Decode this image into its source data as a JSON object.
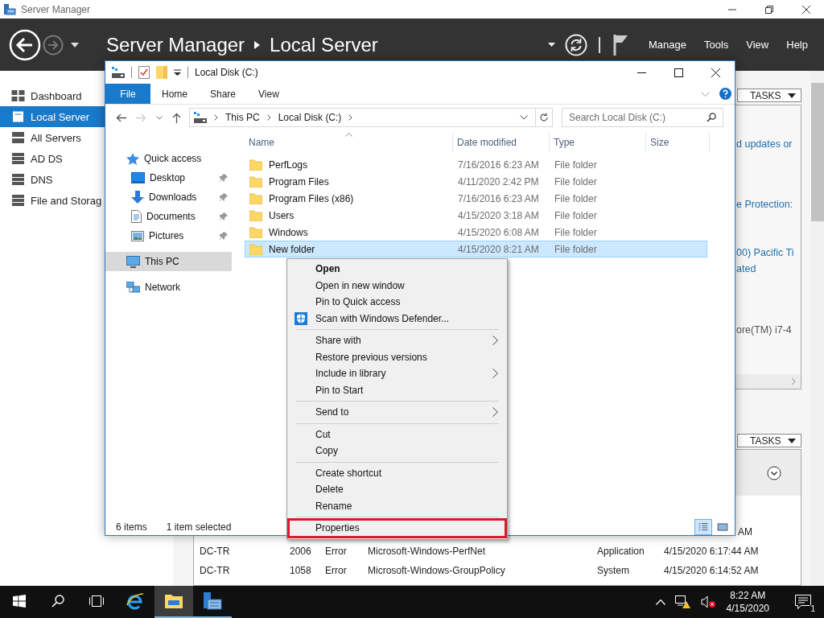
{
  "server_manager": {
    "title": "Server Manager",
    "breadcrumb": [
      "Server Manager",
      "Local Server"
    ],
    "menu": [
      "Manage",
      "Tools",
      "View",
      "Help"
    ],
    "sidebar": [
      {
        "label": "Dashboard",
        "kind": "dashboard",
        "selected": false
      },
      {
        "label": "Local Server",
        "kind": "server",
        "selected": true
      },
      {
        "label": "All Servers",
        "kind": "servers",
        "selected": false
      },
      {
        "label": "AD DS",
        "kind": "role",
        "selected": false
      },
      {
        "label": "DNS",
        "kind": "role",
        "selected": false
      },
      {
        "label": "File and Storag",
        "kind": "role",
        "selected": false
      }
    ],
    "properties": {
      "tasks": "TASKS",
      "fragments": [
        {
          "lines": [
            "d updates or"
          ],
          "kind": "link"
        },
        {
          "lines": [
            "e Protection:"
          ],
          "kind": "link"
        },
        {
          "lines": [
            "00) Pacific Ti",
            "ated"
          ],
          "kind": "link"
        },
        {
          "lines": [
            "ore(TM) i7-4"
          ],
          "kind": "text"
        }
      ]
    },
    "events": {
      "tasks": "TASKS",
      "rows": [
        {
          "date": "AM"
        },
        {
          "server": "DC-TR",
          "id": "2006",
          "severity": "Error",
          "source": "Microsoft-Windows-PerfNet",
          "log": "Application",
          "date": "4/15/2020 6:17:44 AM"
        },
        {
          "server": "DC-TR",
          "id": "1058",
          "severity": "Error",
          "source": "Microsoft-Windows-GroupPolicy",
          "log": "System",
          "date": "4/15/2020 6:14:52 AM"
        }
      ]
    }
  },
  "explorer": {
    "title": "Local Disk (C:)",
    "ribbon_tabs": [
      {
        "label": "File",
        "kind": "menu",
        "selected": false
      },
      {
        "label": "Home",
        "kind": "tab",
        "selected": false
      },
      {
        "label": "Share",
        "kind": "tab",
        "selected": false
      },
      {
        "label": "View",
        "kind": "tab",
        "selected": false
      }
    ],
    "address": [
      "This PC",
      "Local Disk (C:)"
    ],
    "search": {
      "placeholder": "Search Local Disk (C:)"
    },
    "nav": [
      {
        "label": "Quick access",
        "kind": "quick_access",
        "selected": false,
        "children": [
          {
            "label": "Desktop",
            "kind": "desktop",
            "pinned": true,
            "selected": false
          },
          {
            "label": "Downloads",
            "kind": "downloads",
            "pinned": true,
            "selected": false
          },
          {
            "label": "Documents",
            "kind": "documents",
            "pinned": true,
            "selected": false
          },
          {
            "label": "Pictures",
            "kind": "pictures",
            "pinned": true,
            "selected": false
          }
        ]
      },
      {
        "label": "This PC",
        "kind": "pc",
        "selected": true
      },
      {
        "label": "Network",
        "kind": "network",
        "selected": false
      }
    ],
    "columns": [
      {
        "label": "Name",
        "sorted": true
      },
      {
        "label": "Date modified",
        "sorted": false
      },
      {
        "label": "Type",
        "sorted": false
      },
      {
        "label": "Size",
        "sorted": false
      }
    ],
    "files": [
      {
        "name": "PerfLogs",
        "date": "7/16/2016 6:23 AM",
        "type": "File folder",
        "selected": false
      },
      {
        "name": "Program Files",
        "date": "4/11/2020 2:42 PM",
        "type": "File folder",
        "selected": false
      },
      {
        "name": "Program Files (x86)",
        "date": "7/16/2016 6:23 AM",
        "type": "File folder",
        "selected": false
      },
      {
        "name": "Users",
        "date": "4/15/2020 3:18 AM",
        "type": "File folder",
        "selected": false
      },
      {
        "name": "Windows",
        "date": "4/15/2020 6:08 AM",
        "type": "File folder",
        "selected": false
      },
      {
        "name": "New folder",
        "date": "4/15/2020 8:21 AM",
        "type": "File folder",
        "selected": true
      }
    ],
    "status": {
      "count": "6 items",
      "selection": "1 item selected"
    },
    "view_modes": [
      {
        "kind": "details",
        "selected": true
      },
      {
        "kind": "large_icons",
        "selected": false
      }
    ]
  },
  "context_menu": {
    "items": [
      {
        "kind": "item",
        "label": "Open",
        "default": true,
        "icon": false,
        "submenu": false,
        "highlighted": false
      },
      {
        "kind": "item",
        "label": "Open in new window",
        "default": false,
        "icon": false,
        "submenu": false,
        "highlighted": false
      },
      {
        "kind": "item",
        "label": "Pin to Quick access",
        "default": false,
        "icon": false,
        "submenu": false,
        "highlighted": false
      },
      {
        "kind": "item",
        "label": "Scan with Windows Defender...",
        "default": false,
        "icon": true,
        "submenu": false,
        "highlighted": false
      },
      {
        "kind": "separator"
      },
      {
        "kind": "item",
        "label": "Share with",
        "default": false,
        "icon": false,
        "submenu": true,
        "highlighted": false
      },
      {
        "kind": "item",
        "label": "Restore previous versions",
        "default": false,
        "icon": false,
        "submenu": false,
        "highlighted": false
      },
      {
        "kind": "item",
        "label": "Include in library",
        "default": false,
        "icon": false,
        "submenu": true,
        "highlighted": false
      },
      {
        "kind": "item",
        "label": "Pin to Start",
        "default": false,
        "icon": false,
        "submenu": false,
        "highlighted": false
      },
      {
        "kind": "separator"
      },
      {
        "kind": "item",
        "label": "Send to",
        "default": false,
        "icon": false,
        "submenu": true,
        "highlighted": false
      },
      {
        "kind": "separator"
      },
      {
        "kind": "item",
        "label": "Cut",
        "default": false,
        "icon": false,
        "submenu": false,
        "highlighted": false
      },
      {
        "kind": "item",
        "label": "Copy",
        "default": false,
        "icon": false,
        "submenu": false,
        "highlighted": false
      },
      {
        "kind": "separator"
      },
      {
        "kind": "item",
        "label": "Create shortcut",
        "default": false,
        "icon": false,
        "submenu": false,
        "highlighted": false
      },
      {
        "kind": "item",
        "label": "Delete",
        "default": false,
        "icon": false,
        "submenu": false,
        "highlighted": false
      },
      {
        "kind": "item",
        "label": "Rename",
        "default": false,
        "icon": false,
        "submenu": false,
        "highlighted": false
      },
      {
        "kind": "separator"
      },
      {
        "kind": "item",
        "label": "Properties",
        "default": false,
        "icon": false,
        "submenu": false,
        "highlighted": true
      }
    ]
  },
  "taskbar": {
    "apps": [
      {
        "kind": "start",
        "open": false,
        "active": false
      },
      {
        "kind": "search",
        "open": false,
        "active": false
      },
      {
        "kind": "task_view",
        "open": false,
        "active": false
      },
      {
        "kind": "browser",
        "open": false,
        "active": false
      },
      {
        "kind": "explorer",
        "open": true,
        "active": true
      },
      {
        "kind": "server_manager",
        "open": true,
        "active": false
      }
    ],
    "time": "8:22 AM",
    "date": "4/15/2020",
    "notifications": "1"
  }
}
